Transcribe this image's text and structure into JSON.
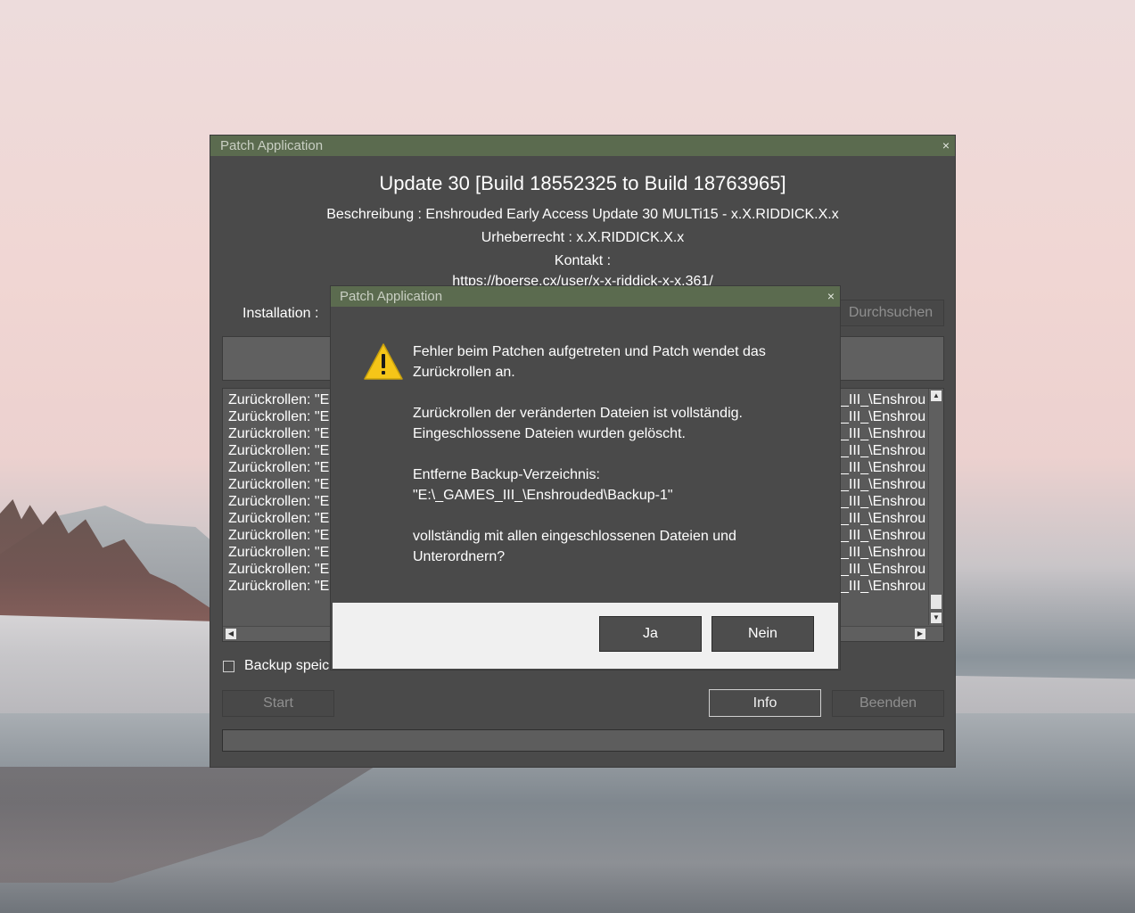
{
  "main_window": {
    "title": "Patch Application",
    "close_glyph": "×",
    "heading": "Update 30 [Build  18552325 to Build 18763965]",
    "description": "Beschreibung : Enshrouded Early Access Update 30 MULTi15 - x.X.RIDDICK.X.x",
    "copyright": "Urheberrecht : x.X.RIDDICK.X.x",
    "contact_label": "Kontakt :",
    "contact_url": "https://boerse.cx/user/x-x-riddick-x-x.361/",
    "install_label": "Installation :",
    "browse_button": "Durchsuchen",
    "log_left": [
      "Zurückrollen: \"E",
      "Zurückrollen: \"E",
      "Zurückrollen: \"E",
      "Zurückrollen: \"E",
      "Zurückrollen: \"E",
      "Zurückrollen: \"E",
      "Zurückrollen: \"E",
      "Zurückrollen: \"E",
      "Zurückrollen: \"E",
      "Zurückrollen: \"E",
      "Zurückrollen: \"E",
      "Zurückrollen: \"E"
    ],
    "log_right": [
      "_III_\\Enshrou",
      "_III_\\Enshrou",
      "_III_\\Enshrou",
      "_III_\\Enshrou",
      "_III_\\Enshrou",
      "_III_\\Enshrou",
      "_III_\\Enshrou",
      "_III_\\Enshrou",
      "_III_\\Enshrou",
      "_III_\\Enshrou",
      "_III_\\Enshrou",
      "_III_\\Enshrou"
    ],
    "backup_label": "Backup speich",
    "start_button": "Start",
    "info_button": "Info",
    "quit_button": "Beenden"
  },
  "dialog": {
    "title": "Patch Application",
    "close_glyph": "×",
    "icon": "warning-icon",
    "message": {
      "p1": "Fehler beim Patchen aufgetreten und Patch wendet das Zurückrollen an.",
      "p2": "Zurückrollen der veränderten Dateien ist vollständig. Eingeschlossene Dateien wurden gelöscht.",
      "p3a": "Entferne Backup-Verzeichnis:",
      "p3b": "\"E:\\_GAMES_III_\\Enshrouded\\Backup-1\"",
      "p4": "vollständig mit allen eingeschlossenen Dateien und Unterordnern?"
    },
    "yes_button": "Ja",
    "no_button": "Nein"
  },
  "colors": {
    "titlebar": "#5b6b4f",
    "window_bg": "#4a4a4a",
    "warning_yellow": "#f5c518"
  }
}
